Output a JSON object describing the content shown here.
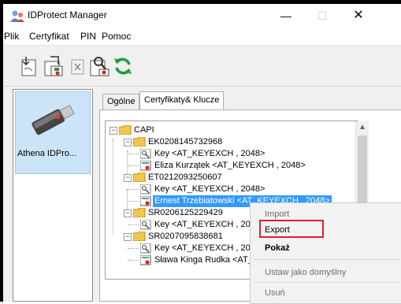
{
  "window": {
    "title": "IDProtect Manager",
    "minimize": "—",
    "maximize": "☐",
    "close": "✕"
  },
  "menu": [
    "Plik",
    "Certyfikat",
    "PIN",
    "Pomoc"
  ],
  "toolbar": {
    "icons": [
      "import-cert-icon",
      "save-cert-icon",
      "close-doc-icon",
      "inspect-cert-icon",
      "refresh-icon"
    ]
  },
  "devices": [
    {
      "label": "Athena IDPro..."
    }
  ],
  "tabs": [
    {
      "label": "Ogólne"
    },
    {
      "label": "Certyfikaty& Klucze",
      "active": true
    }
  ],
  "tree": {
    "root": "CAPI",
    "nodes": [
      {
        "label": "EK0208145732968",
        "children": [
          {
            "type": "key",
            "label": "Key  <AT_KEYEXCH , 2048>"
          },
          {
            "type": "cert",
            "label": "Eliza Kurzątek <AT_KEYEXCH , 2048>"
          }
        ]
      },
      {
        "label": "ET0212093250607",
        "children": [
          {
            "type": "key",
            "label": "Key  <AT_KEYEXCH , 2048>"
          },
          {
            "type": "cert",
            "label": "Ernest Trzebiatowski <AT_KEYEXCH , 2048>",
            "selected": true
          }
        ]
      },
      {
        "label": "SR0206125229429",
        "children": [
          {
            "type": "key",
            "label": "Key  <AT_KEYEXCH , 2048>"
          }
        ]
      },
      {
        "label": "SR0207095838681",
        "children": [
          {
            "type": "key",
            "label": "Key  <AT_KEYEXCH , 2048>"
          },
          {
            "type": "cert",
            "label": "Sława Kinga Rudka <AT_KEYEXCH , 2048>"
          }
        ]
      }
    ]
  },
  "context_menu": {
    "items": [
      {
        "label": "Import",
        "enabled": false
      },
      {
        "label": "Export",
        "enabled": true,
        "highlighted": true
      },
      {
        "label": "Pokaż",
        "enabled": true,
        "bold": true
      },
      {
        "label": "Ustaw jako domyślny",
        "enabled": false
      },
      {
        "label": "Usuń",
        "enabled": false
      }
    ]
  },
  "colors": {
    "selection": "#3399ff",
    "highlight_border": "#e0202a",
    "device_selected": "#cce4f7"
  }
}
